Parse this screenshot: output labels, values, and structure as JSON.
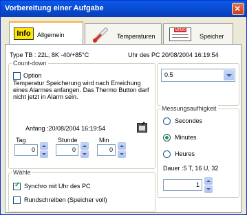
{
  "window": {
    "title": "Vorbereitung einer Aufgabe"
  },
  "tabs": [
    {
      "icon": "info-icon",
      "icon_text": "Info",
      "label": "Allgemein"
    },
    {
      "icon": "thermometer-icon",
      "label": "Temperaturen"
    },
    {
      "icon": "memo-icon",
      "icon_text": "MEMO",
      "label": "Speicher"
    }
  ],
  "info": {
    "type_text": "Type TB :     22L, 8K -40/+85°C",
    "pc_clock_text": "Uhr des PC   20/08/2004    16:19:54"
  },
  "countdown": {
    "legend": "Count-down",
    "option_label": "Option",
    "option_checked": false,
    "description": "Temperatur Speicherung wird nach Erreichung eines Alarmes anfangen. Das Thermo Button darf nicht jetzt in Alarm sein.",
    "start_text": "Anfang :20/08/2004 16:19:54",
    "tag_label": "Tag",
    "tag_value": "0",
    "stunde_label": "Stunde",
    "stunde_value": "0",
    "min_label": "Min",
    "min_value": "0"
  },
  "rate_select": {
    "value": "0.5"
  },
  "measurement": {
    "legend": "Messungsaufhigkeit",
    "options": [
      "Secondes",
      "Minutes",
      "Heures"
    ],
    "selected": "Minutes",
    "duration_text": "Dauer :5 T, 16 U, 32",
    "interval_value": "1"
  },
  "choose": {
    "legend": "Wähle",
    "sync_label": "Synchro mit Uhr des PC",
    "sync_checked": true,
    "overwrite_label": "Rundschreiben (Speicher voll)",
    "overwrite_checked": false
  },
  "colors": {
    "title_bar": "#0a4fd4",
    "tab_highlight": "#f8b33a",
    "check_green": "#21a121"
  }
}
